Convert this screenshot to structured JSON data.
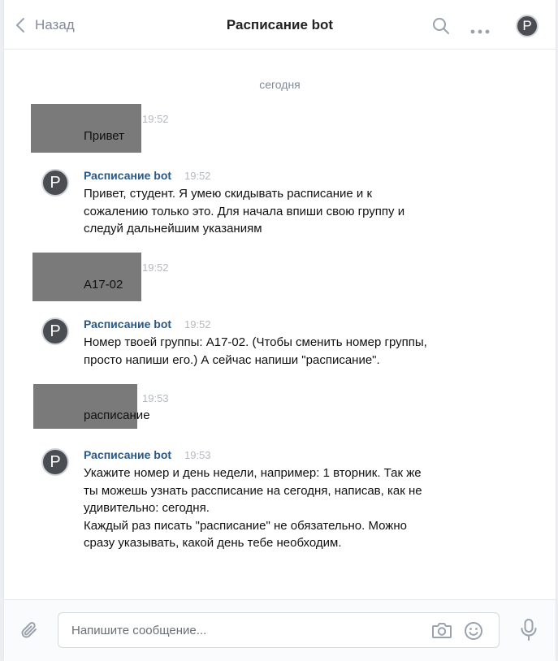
{
  "header": {
    "back_label": "Назад",
    "title": "Расписание bot",
    "avatar_letter": "P"
  },
  "date_separator": "сегодня",
  "messages": [
    {
      "from": "user",
      "time": "19:52",
      "text": "Привет"
    },
    {
      "from": "bot",
      "sender": "Расписание bot",
      "time": "19:52",
      "avatar_letter": "P",
      "lines": [
        "Привет, студент. Я умею скидывать расписание и к",
        "сожалению только это. Для начала впиши свою группу  и",
        "следуй дальнейшим указаниям"
      ]
    },
    {
      "from": "user",
      "time": "19:52",
      "text": "А17-02"
    },
    {
      "from": "bot",
      "sender": "Расписание bot",
      "time": "19:52",
      "avatar_letter": "P",
      "lines": [
        "Номер твоей группы: А17-02. (Чтобы сменить номер группы,",
        "просто напиши его.) А сейчас  напиши \"расписание\"."
      ]
    },
    {
      "from": "user",
      "time": "19:53",
      "text": "расписание"
    },
    {
      "from": "bot",
      "sender": "Расписание bot",
      "time": "19:53",
      "avatar_letter": "P",
      "lines": [
        "Укажите номер и день недели, например: 1 вторник. Так же",
        "ты можешь узнать рассписание на сегодня, написав, как не",
        "удивительно: сегодня.",
        "Каждый раз писать \"расписание\" не обязательно. Можно",
        "сразу указывать, какой день тебе необходим."
      ]
    }
  ],
  "composer": {
    "placeholder": "Напишите сообщение..."
  },
  "icons": {
    "back": "chevron-left-icon",
    "search": "search-icon",
    "more": "more-icon",
    "attach": "paperclip-icon",
    "camera": "camera-icon",
    "emoji": "emoji-icon",
    "mic": "microphone-icon"
  },
  "colors": {
    "link": "#2a5885",
    "muted": "#828a99",
    "redaction": "#7a7a7a"
  }
}
